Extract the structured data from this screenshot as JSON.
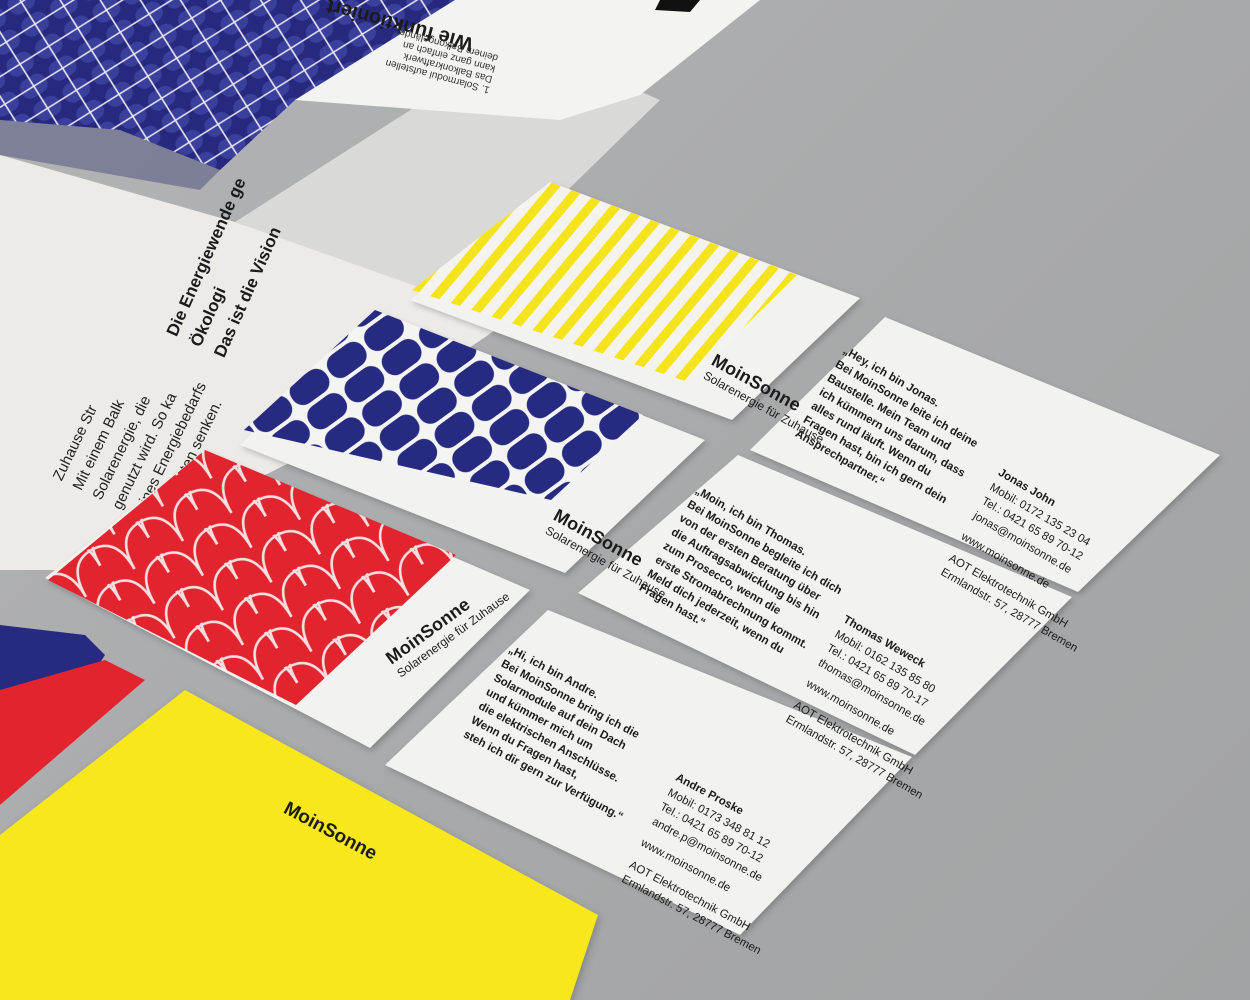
{
  "colors": {
    "surface": "#a9aaab",
    "card_white": "#f1f1ef",
    "navy": "#252a7c",
    "red": "#e2242f",
    "yellow": "#f7e41a",
    "ink": "#1b1b1b"
  },
  "brand": {
    "name": "MoinSonne",
    "tagline": "Solarenergie für Zuhause"
  },
  "brochure": {
    "heading": "Wie funktioniert",
    "step_1": "1. Solarmodul aufstellen",
    "step_lines": [
      "Das Balkonkraftwerk",
      "kann ganz einfach an",
      "deinem Balkongeländer"
    ],
    "vision_lines": [
      "Die Energiewende ge",
      "Ökologi",
      "Das ist die Vision"
    ],
    "body_lines": [
      "Zuhause Str",
      "Mit einem Balk",
      "Solarenergie, die",
      "genutzt wird. So ka",
      "deines Energiebedarfs",
      "Stromkosten senken."
    ]
  },
  "cards": {
    "jonas": {
      "quote": [
        "„Hey, ich bin Jonas.",
        "Bei MoinSonne leite ich deine",
        "Baustelle. Mein Team und",
        "ich kümmern uns darum, dass",
        "alles rund läuft. Wenn du",
        "Fragen hast, bin ich gern dein",
        "Ansprechpartner.“"
      ],
      "name": "Jonas John",
      "mobile": "Mobil: 0172 135 23 04",
      "tel": "Tel.: 0421 65 89 70-12",
      "email": "jonas@moinsonne.de",
      "web": "www.moinsonne.de",
      "company": "AOT Elektrotechnik GmbH",
      "address": "Ermlandstr. 57, 28777 Bremen"
    },
    "thomas": {
      "quote": [
        "„Moin, ich bin Thomas.",
        "Bei MoinSonne begleite ich dich",
        "von der ersten Beratung über",
        "die Auftragsabwicklung bis hin",
        "zum Prosecco, wenn die",
        "erste Stromabrechnung kommt.",
        "Meld dich jederzeit, wenn du",
        "Fragen hast.“"
      ],
      "name": "Thomas Weweck",
      "mobile": "Mobil: 0162 135 85 80",
      "tel": "Tel.: 0421 65 89 70-17",
      "email": "thomas@moinsonne.de",
      "web": "www.moinsonne.de",
      "company": "AOT Elektrotechnik GmbH",
      "address": "Ermlandstr. 57, 28777 Bremen"
    },
    "andre": {
      "quote": [
        "„Hi, ich bin Andre.",
        "Bei MoinSonne bring ich die",
        "Solarmodule auf dein Dach",
        "und kümmer mich um",
        "die elektrischen Anschlüsse.",
        "Wenn du Fragen hast,",
        "steh ich dir gern zur Verfügung.“"
      ],
      "name": "Andre Proske",
      "mobile": "Mobil: 0173 348 81 12",
      "tel": "Tel.: 0421 65 89 70-12",
      "email": "andre.p@moinsonne.de",
      "web": "www.moinsonne.de",
      "company": "AOT Elektrotechnik GmbH",
      "address": "Ermlandstr. 57, 28777 Bremen"
    }
  },
  "yellow_card_logo": "MoinSonne"
}
